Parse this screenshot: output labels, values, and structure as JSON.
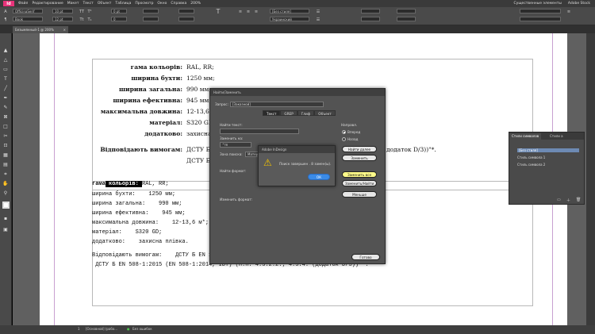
{
  "menubar": {
    "app": "Id",
    "items": [
      "Файл",
      "Редактирование",
      "Макет",
      "Текст",
      "Объект",
      "Таблица",
      "Просмотр",
      "Окно",
      "Справка"
    ],
    "zoom": "200%",
    "workspace": "Существенные элементы",
    "search_placeholder": "Adobe Stock"
  },
  "control": {
    "font_name": "OfficinaSerif",
    "font_style": "Book",
    "size_field": "10 pt",
    "leading_field": "12 pt",
    "paragraph_style": "[Без стиля]",
    "lang_field": "Украинский",
    "kerning": "0 pt",
    "tracking": "0"
  },
  "tab": {
    "title": "Безымянный-1 @ 200%",
    "close": "×"
  },
  "document": {
    "table_rows": [
      {
        "label": "гама кольорів:",
        "value": "RAL, RR;"
      },
      {
        "label": "ширина бухти:",
        "value": "1250 мм;"
      },
      {
        "label": "ширина загальна:",
        "value": "990 мм;"
      },
      {
        "label": "ширина ефективна:",
        "value": "945 мм;"
      },
      {
        "label": "максимальна довжина:",
        "value": "12-13,6"
      },
      {
        "label": "матеріал:",
        "value": "S320 GD;"
      },
      {
        "label": "додатково:",
        "value": "захисна"
      }
    ],
    "req_label": "Відповідають вимогам:",
    "req_line1": "ДСТУ Б",
    "req_line2": "ДСТУ Б",
    "req_tail": "додаток D/3))\"*.",
    "plain": {
      "line1_a": "гама",
      "line1_sel": " кольорів: ",
      "line1_b": "RAL, RR;",
      "line1_sel_text": "кольорів",
      "line2": "ширина бухти:    1250 мм;",
      "line3": "ширина загальна:    990 мм;",
      "line4": "ширина ефективна:    945 мм;",
      "line5": "максимальна довжина:    12-13,6 м*;",
      "line6": "матеріал:    S320 GD;",
      "line7": "додатково:    захисна плівка.",
      "line8": "Відповідають вимогам:    ДСТУ Б EN 14782:2015 (EN 14782:2006, IDT) (п.п. 4.2; 4.4; 4.7);",
      "line9": " ДСТУ Б EN 508-1:2015 (EN 508-1:2014, IDT) (п.п. 4.3.2.2.; 4.3.4. (додаток D/3))**."
    }
  },
  "find_dialog": {
    "title": "Найти/Заменить",
    "query_label": "Запрос:",
    "query_value": "[Заказной]",
    "tabs": [
      "Текст",
      "GREP",
      "Глиф",
      "Объект"
    ],
    "active_tab": "Текст",
    "find_label": "Найти текст:",
    "replace_label": "Заменить на:",
    "replace_value": "^m",
    "search_label": "Зона поиска:",
    "search_value": "Материал",
    "find_format_label": "Найти формат:",
    "change_format_label": "Изменить формат:",
    "direction_label": "Направл.",
    "dir_forward": "Вперед",
    "dir_back": "Назад",
    "btn_find": "Найти далее",
    "btn_change": "Заменить",
    "btn_change_all": "Заменить все",
    "btn_change_find": "Заменить/Найти",
    "btn_fewer": "Меньше",
    "btn_done": "Готово"
  },
  "alert": {
    "title": "Adobe InDesign",
    "message": "Поиск завершен . 8 замен(ы).",
    "ok": "ОК"
  },
  "panel": {
    "tab1": "Стили символов",
    "tab2": "Стили а",
    "items": [
      "[Без стиля]",
      "Стиль символа 1",
      "Стиль символа 2"
    ],
    "selected": "[Без стиля]"
  },
  "status": {
    "page": "1",
    "style": "[Основной] (рабо...",
    "preflight": "Без ошибок"
  }
}
